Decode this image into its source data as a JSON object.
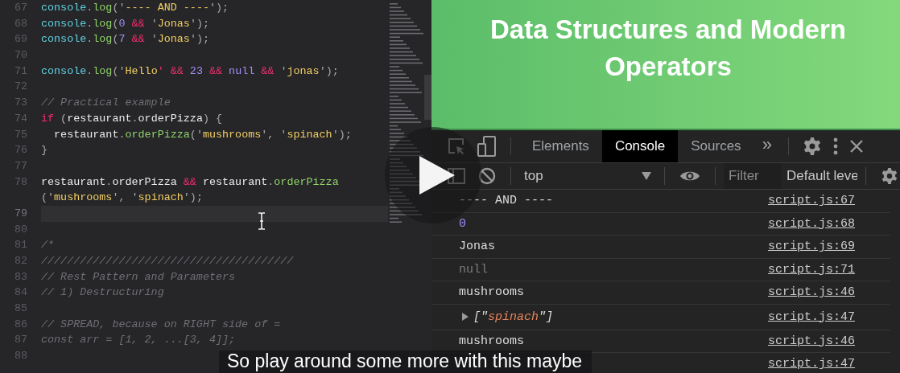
{
  "editor": {
    "lines": [
      {
        "number": "67",
        "active": false,
        "tokens": [
          {
            "text": "console",
            "kind": "obj"
          },
          {
            "text": ".",
            "kind": "punct"
          },
          {
            "text": "log",
            "kind": "fn"
          },
          {
            "text": "('",
            "kind": "punct"
          },
          {
            "text": "---- AND ----",
            "kind": "str"
          },
          {
            "text": "');",
            "kind": "punct"
          }
        ]
      },
      {
        "number": "68",
        "active": false,
        "tokens": [
          {
            "text": "console",
            "kind": "obj"
          },
          {
            "text": ".",
            "kind": "punct"
          },
          {
            "text": "log",
            "kind": "fn"
          },
          {
            "text": "(",
            "kind": "punct"
          },
          {
            "text": "0",
            "kind": "num"
          },
          {
            "text": " && ",
            "kind": "op"
          },
          {
            "text": "'",
            "kind": "punct"
          },
          {
            "text": "Jonas",
            "kind": "str"
          },
          {
            "text": "');",
            "kind": "punct"
          }
        ]
      },
      {
        "number": "69",
        "active": false,
        "tokens": [
          {
            "text": "console",
            "kind": "obj"
          },
          {
            "text": ".",
            "kind": "punct"
          },
          {
            "text": "log",
            "kind": "fn"
          },
          {
            "text": "(",
            "kind": "punct"
          },
          {
            "text": "7",
            "kind": "num"
          },
          {
            "text": " && ",
            "kind": "op"
          },
          {
            "text": "'",
            "kind": "punct"
          },
          {
            "text": "Jonas",
            "kind": "str"
          },
          {
            "text": "');",
            "kind": "punct"
          }
        ]
      },
      {
        "number": "70",
        "active": false
      },
      {
        "number": "71",
        "active": false,
        "tokens": [
          {
            "text": "console",
            "kind": "obj"
          },
          {
            "text": ".",
            "kind": "punct"
          },
          {
            "text": "log",
            "kind": "fn"
          },
          {
            "text": "('",
            "kind": "punct"
          },
          {
            "text": "Hello",
            "kind": "str"
          },
          {
            "text": "' && ",
            "kind": "op"
          },
          {
            "text": "23",
            "kind": "num"
          },
          {
            "text": " && ",
            "kind": "op"
          },
          {
            "text": "null",
            "kind": "num"
          },
          {
            "text": " && ",
            "kind": "op"
          },
          {
            "text": "'",
            "kind": "punct"
          },
          {
            "text": "jonas",
            "kind": "str"
          },
          {
            "text": "');",
            "kind": "punct"
          }
        ]
      },
      {
        "number": "72",
        "active": false
      },
      {
        "number": "73",
        "active": false,
        "tokens": [
          {
            "text": "// Practical example",
            "kind": "comment"
          }
        ]
      },
      {
        "number": "74",
        "active": false,
        "tokens": [
          {
            "text": "if",
            "kind": "kw"
          },
          {
            "text": " (",
            "kind": "punct"
          },
          {
            "text": "restaurant",
            "kind": "plain"
          },
          {
            "text": ".",
            "kind": "punct"
          },
          {
            "text": "orderPizza",
            "kind": "plain"
          },
          {
            "text": ") {",
            "kind": "punct"
          }
        ]
      },
      {
        "number": "75",
        "active": false,
        "tokens": [
          {
            "text": "  restaurant",
            "kind": "plain"
          },
          {
            "text": ".",
            "kind": "punct"
          },
          {
            "text": "orderPizza",
            "kind": "fn"
          },
          {
            "text": "('",
            "kind": "punct"
          },
          {
            "text": "mushrooms",
            "kind": "str"
          },
          {
            "text": "', '",
            "kind": "punct"
          },
          {
            "text": "spinach",
            "kind": "str"
          },
          {
            "text": "');",
            "kind": "punct"
          }
        ]
      },
      {
        "number": "76",
        "active": false,
        "tokens": [
          {
            "text": "}",
            "kind": "punct"
          }
        ]
      },
      {
        "number": "77",
        "active": false
      },
      {
        "number": "78",
        "active": false,
        "tokens": [
          {
            "text": "restaurant",
            "kind": "plain"
          },
          {
            "text": ".",
            "kind": "punct"
          },
          {
            "text": "orderPizza",
            "kind": "plain"
          },
          {
            "text": " && ",
            "kind": "op"
          },
          {
            "text": "restaurant",
            "kind": "plain"
          },
          {
            "text": ".",
            "kind": "punct"
          },
          {
            "text": "orderPizza",
            "kind": "fn"
          }
        ],
        "continuation": [
          {
            "text": "('",
            "kind": "punct"
          },
          {
            "text": "mushrooms",
            "kind": "str"
          },
          {
            "text": "', '",
            "kind": "punct"
          },
          {
            "text": "spinach",
            "kind": "str"
          },
          {
            "text": "');",
            "kind": "punct"
          }
        ]
      },
      {
        "number": "79",
        "active": true
      },
      {
        "number": "80",
        "active": false
      },
      {
        "number": "81",
        "active": false,
        "tokens": [
          {
            "text": "/*",
            "kind": "comment"
          }
        ]
      },
      {
        "number": "82",
        "active": false,
        "tokens": [
          {
            "text": "///////////////////////////////////////",
            "kind": "comment"
          }
        ]
      },
      {
        "number": "83",
        "active": false,
        "tokens": [
          {
            "text": "// Rest Pattern and Parameters",
            "kind": "comment"
          }
        ]
      },
      {
        "number": "84",
        "active": false,
        "tokens": [
          {
            "text": "// 1) Destructuring",
            "kind": "comment"
          }
        ]
      },
      {
        "number": "85",
        "active": false
      },
      {
        "number": "86",
        "active": false,
        "tokens": [
          {
            "text": "// SPREAD, because on RIGHT side of =",
            "kind": "comment"
          }
        ]
      },
      {
        "number": "87",
        "active": false,
        "tokens": [
          {
            "text": "const arr = [1, 2, ...[3, 4]];",
            "kind": "comment"
          }
        ]
      },
      {
        "number": "88",
        "active": false
      }
    ]
  },
  "page": {
    "title": "Data Structures and Modern Operators"
  },
  "devtools": {
    "tabs": [
      {
        "label": "Elements",
        "selected": false
      },
      {
        "label": "Console",
        "selected": true
      },
      {
        "label": "Sources",
        "selected": false
      }
    ],
    "more": "»",
    "context": "top",
    "filter": {
      "placeholder": "Filter"
    },
    "levels": "Default leve",
    "rows": [
      {
        "kind": "text",
        "parts": [
          "---- AND ----"
        ],
        "source": "script.js:67"
      },
      {
        "kind": "number",
        "parts": [
          "0"
        ],
        "source": "script.js:68"
      },
      {
        "kind": "text",
        "parts": [
          "Jonas"
        ],
        "source": "script.js:69"
      },
      {
        "kind": "null",
        "parts": [
          "null"
        ],
        "source": "script.js:71"
      },
      {
        "kind": "text",
        "parts": [
          "mushrooms"
        ],
        "source": "script.js:46"
      },
      {
        "kind": "array",
        "parts": [
          "[\"",
          "spinach",
          "\"]"
        ],
        "source": "script.js:47"
      },
      {
        "kind": "text",
        "parts": [
          "mushrooms"
        ],
        "source": "script.js:46"
      },
      {
        "kind": "hidden",
        "source": "script.js:47"
      }
    ]
  },
  "subtitle": "So play around some more with this maybe"
}
